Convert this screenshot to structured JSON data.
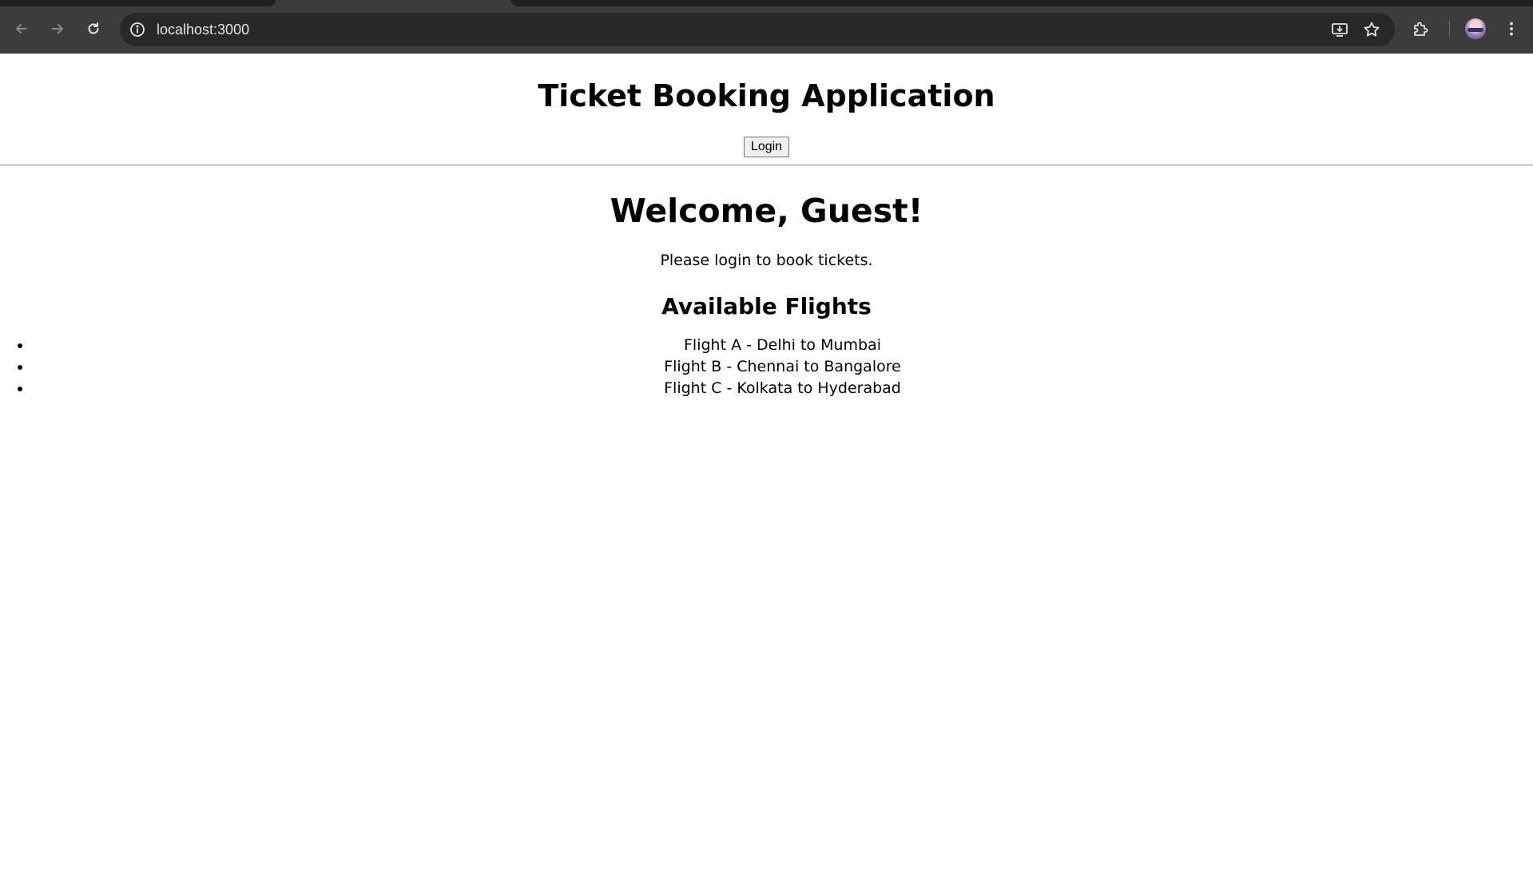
{
  "browser": {
    "url": "localhost:3000",
    "icons": {
      "back": "arrow-left-icon",
      "forward": "arrow-right-icon",
      "reload": "reload-icon",
      "site_info": "info-icon",
      "install": "install-app-icon",
      "bookmark": "star-icon",
      "extensions": "puzzle-icon",
      "profile": "avatar",
      "menu": "kebab-menu-icon"
    }
  },
  "header": {
    "title": "Ticket Booking Application",
    "login_label": "Login"
  },
  "main": {
    "welcome": "Welcome, Guest!",
    "prompt": "Please login to book tickets.",
    "flights_heading": "Available Flights",
    "flights": [
      "Flight A - Delhi to Mumbai",
      "Flight B - Chennai to Bangalore",
      "Flight C - Kolkata to Hyderabad"
    ]
  }
}
